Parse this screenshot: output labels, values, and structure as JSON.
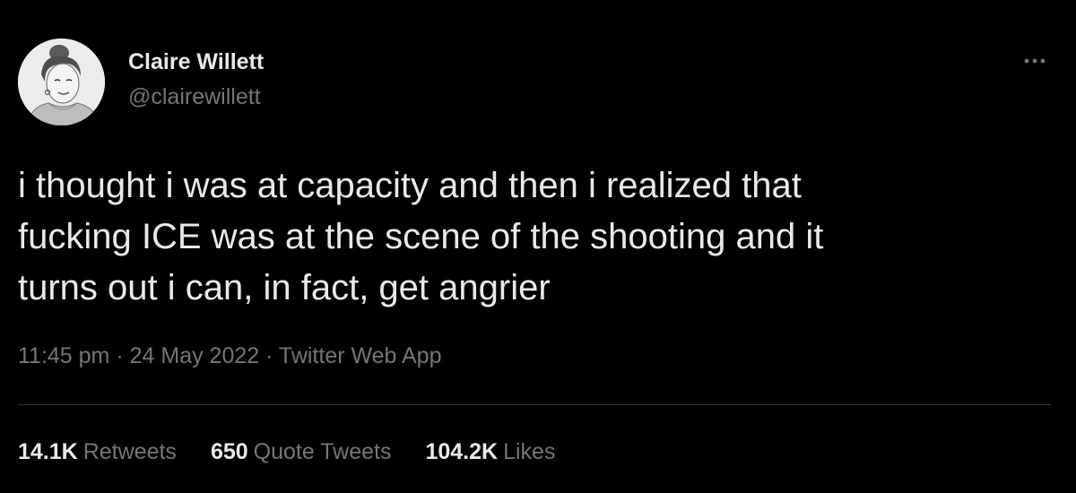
{
  "author": {
    "name": "Claire Willett",
    "handle": "@clairewillett",
    "avatar_icon": "profile-photo"
  },
  "more_icon": "ellipsis-icon",
  "tweet": {
    "text": "i thought i was at capacity and then i realized that\nfucking ICE was at the scene of the shooting and it\nturns out i can, in fact, get angrier",
    "time": "11:45 pm",
    "separator": " · ",
    "date": "24 May 2022",
    "source": "Twitter Web App"
  },
  "stats": {
    "retweets": {
      "count": "14.1K",
      "label": "Retweets"
    },
    "quote_tweets": {
      "count": "650",
      "label": "Quote Tweets"
    },
    "likes": {
      "count": "104.2K",
      "label": "Likes"
    }
  },
  "colors": {
    "background": "#000000",
    "primary_text": "#e7e9ea",
    "secondary_text": "#71767b",
    "divider": "#2f3336"
  }
}
